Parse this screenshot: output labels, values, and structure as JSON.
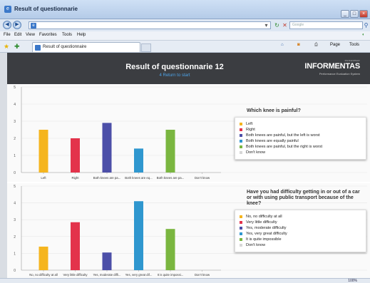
{
  "window": {
    "title": "Result of questionnarie"
  },
  "address_bar": {
    "url": "",
    "search_placeholder": "Google"
  },
  "menu": [
    "File",
    "Edit",
    "View",
    "Favorites",
    "Tools",
    "Help"
  ],
  "tab": {
    "label": "Result of questionnaire"
  },
  "toolbar": {
    "page_label": "Page",
    "tools_label": "Tools"
  },
  "page": {
    "title": "Result of questionnarie 12",
    "return_link": "4 Return to start"
  },
  "logo": {
    "tagline": "REMEMBER",
    "name": "INFORMENTAS",
    "subtitle": "Performance Evaluation System"
  },
  "colors": {
    "orange": "#f5b51e",
    "red": "#e3334b",
    "purple": "#4c4fa8",
    "blue": "#2f97cf",
    "green": "#7ab640",
    "lightgray": "#d7d7d7",
    "header_bg": "#3b3d41"
  },
  "chart_data": [
    {
      "type": "bar",
      "question": "Which knee is painful?",
      "categories": [
        "Left",
        "Right",
        "Both knees are pa...",
        "Both knees are eq...",
        "Both knees are pa...",
        "Don't know"
      ],
      "legend": [
        "Left",
        "Right",
        "Both knees are painful, but the left is worst",
        "Both knees are equally painful",
        "Both knees are painful, but the right is worst",
        "Don't know"
      ],
      "values": [
        2.5,
        2.0,
        2.9,
        1.4,
        2.5,
        0
      ],
      "ylim": [
        0,
        5
      ],
      "yticks": [
        "0",
        "1",
        "2",
        "3",
        "4",
        "5"
      ],
      "grid": true,
      "legend_position": "right"
    },
    {
      "type": "bar",
      "question": "Have you had difficulty getting in or out of a car or with using public transport because of the knee?",
      "categories": [
        "No, no difficulty at all",
        "Very little difficulty",
        "Yes, moderate diffi...",
        "Yes, very great dif...",
        "It is quite impossi...",
        "Don't know"
      ],
      "legend": [
        "No, no difficulty at all",
        "Very little difficulty",
        "Yes, moderate difficulty",
        "Yes, very great difficulty",
        "It is quite impossible",
        "Don't know"
      ],
      "values": [
        1.4,
        2.85,
        1.05,
        4.1,
        2.45,
        0
      ],
      "ylim": [
        0,
        5
      ],
      "yticks": [
        "0",
        "1",
        "2",
        "3",
        "4",
        "5"
      ],
      "grid": true,
      "legend_position": "right"
    }
  ],
  "status": {
    "zoom": "100%"
  }
}
